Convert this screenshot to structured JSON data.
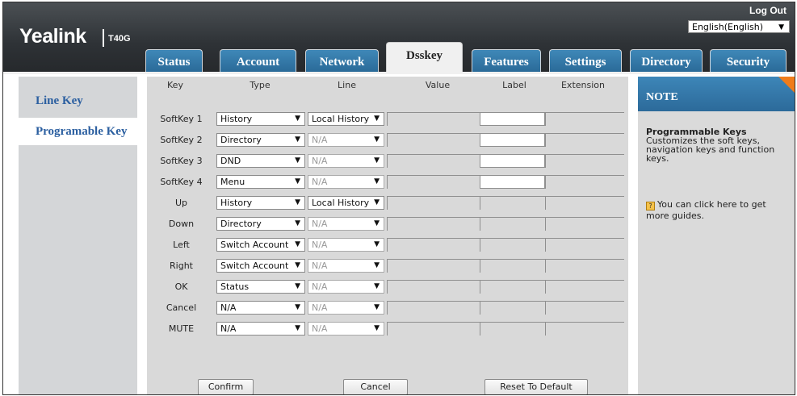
{
  "header": {
    "logo": "Yealink",
    "model": "T40G",
    "logout": "Log Out",
    "language": "English(English)"
  },
  "tabs": [
    {
      "label": "Status"
    },
    {
      "label": "Account"
    },
    {
      "label": "Network"
    },
    {
      "label": "Dsskey"
    },
    {
      "label": "Features"
    },
    {
      "label": "Settings"
    },
    {
      "label": "Directory"
    },
    {
      "label": "Security"
    }
  ],
  "sidebar": {
    "items": [
      {
        "label": "Line Key"
      },
      {
        "label": "Programable Key"
      }
    ]
  },
  "table": {
    "headers": {
      "key": "Key",
      "type": "Type",
      "line": "Line",
      "value": "Value",
      "label": "Label",
      "extension": "Extension"
    },
    "rows": [
      {
        "key": "SoftKey 1",
        "type": "History",
        "line": "Local History"
      },
      {
        "key": "SoftKey 2",
        "type": "Directory",
        "line": "N/A"
      },
      {
        "key": "SoftKey 3",
        "type": "DND",
        "line": "N/A"
      },
      {
        "key": "SoftKey 4",
        "type": "Menu",
        "line": "N/A"
      },
      {
        "key": "Up",
        "type": "History",
        "line": "Local History"
      },
      {
        "key": "Down",
        "type": "Directory",
        "line": "N/A"
      },
      {
        "key": "Left",
        "type": "Switch Account",
        "line": "N/A"
      },
      {
        "key": "Right",
        "type": "Switch Account",
        "line": "N/A"
      },
      {
        "key": "OK",
        "type": "Status",
        "line": "N/A"
      },
      {
        "key": "Cancel",
        "type": "N/A",
        "line": "N/A"
      },
      {
        "key": "MUTE",
        "type": "N/A",
        "line": "N/A"
      }
    ]
  },
  "buttons": {
    "confirm": "Confirm",
    "cancel": "Cancel",
    "reset": "Reset To Default"
  },
  "note": {
    "heading": "NOTE",
    "title": "Programmable Keys",
    "text": "Customizes the soft keys, navigation keys and function keys.",
    "guide": "You can click here to get more guides."
  },
  "colors": {
    "tab_blue": "#2f74a6",
    "sidebar_link": "#2b5fa0",
    "note_accent": "#f07c1a"
  }
}
